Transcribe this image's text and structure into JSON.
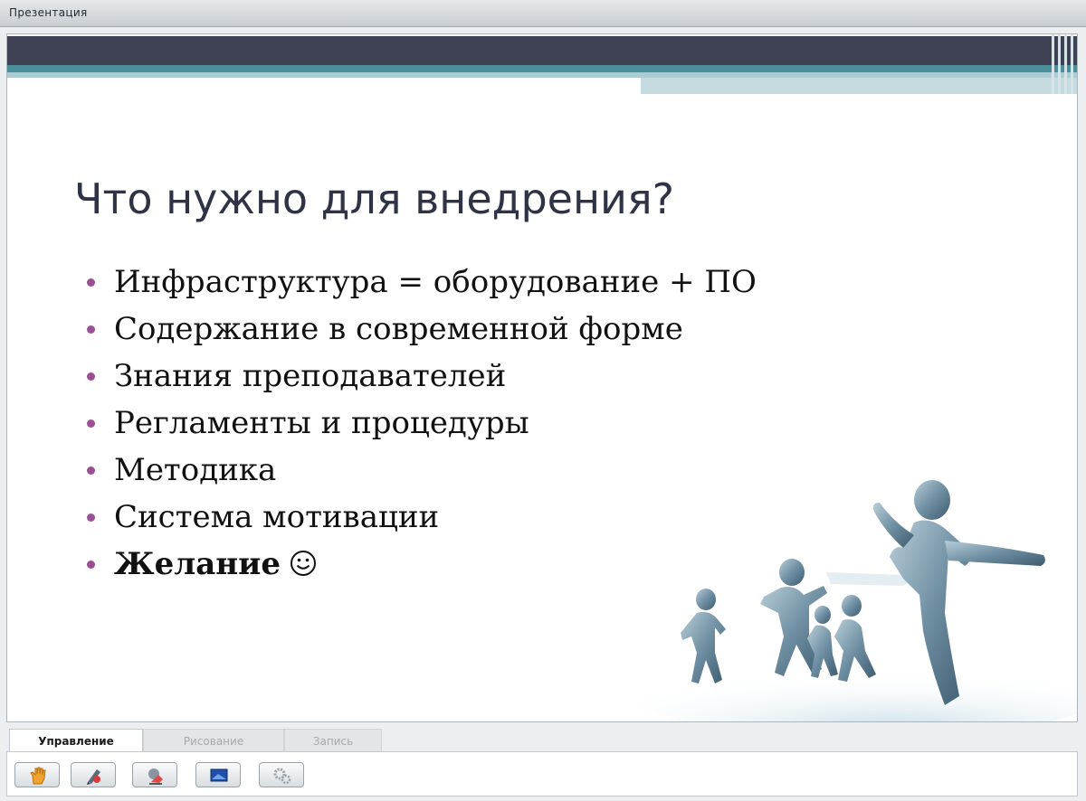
{
  "window": {
    "title": "Презентация"
  },
  "slide": {
    "title": "Что нужно для внедрения?",
    "bullets": [
      "Инфраструктура = оборудование + ПО",
      "Содержание в современной форме",
      "Знания преподавателей",
      "Регламенты и процедуры",
      "Методика",
      "Система мотивации",
      "Желание"
    ],
    "last_bullet_icon": "smiley-icon",
    "image": "runners-image"
  },
  "tabs": [
    {
      "label": "Управление",
      "active": true
    },
    {
      "label": "Рисование",
      "active": false
    },
    {
      "label": "Запись",
      "active": false
    }
  ],
  "toolbar": {
    "buttons": [
      {
        "icon": "hand-icon"
      },
      {
        "icon": "pointer-pen-icon"
      },
      {
        "icon": "eraser-icon"
      },
      {
        "icon": "screen-icon"
      },
      {
        "icon": "settings-gears-icon"
      }
    ]
  },
  "colors": {
    "header_dark": "#3f4154",
    "header_teal": "#4b8f9a",
    "bullet": "#9c4f95",
    "title_text": "#2f3346"
  }
}
